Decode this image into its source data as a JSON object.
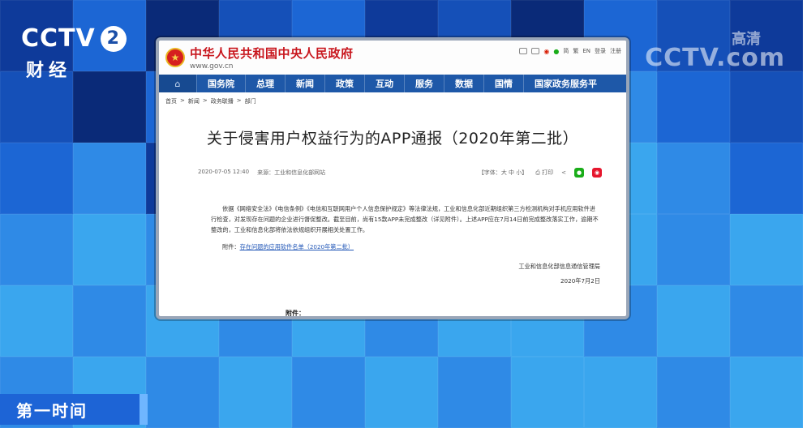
{
  "channel": {
    "logo": "CCTV",
    "number": "2",
    "name": "财经"
  },
  "hd_badge": {
    "label": "高清",
    "logo": "CCTV.com"
  },
  "site": {
    "title": "中华人民共和国中央人民政府",
    "url": "www.gov.cn",
    "emblem": "national-emblem-icon",
    "top_links": [
      "简",
      "繁",
      "EN",
      "登录",
      "注册"
    ],
    "nav": [
      "国务院",
      "总理",
      "新闻",
      "政策",
      "互动",
      "服务",
      "数据",
      "国情",
      "国家政务服务平"
    ]
  },
  "breadcrumb": [
    "首页",
    "新闻",
    "政务联播",
    "部门"
  ],
  "article": {
    "title": "关于侵害用户权益行为的APP通报（2020年第二批）",
    "date": "2020-07-05 12:40",
    "source_label": "来源：",
    "source": "工业和信息化部网站",
    "font_size_label": "【字体：",
    "font_sizes": [
      "大",
      "中",
      "小"
    ],
    "font_size_close": "】",
    "print_label": "打印",
    "paragraph": "依据《网络安全法》《电信条例》《电信和互联网用户个人信息保护规定》等法律法规，工业和信息化部近期组织第三方检测机构对手机应用软件进行检查，对发现存在问题的企业进行督促整改。截至目前，尚有15款APP未完成整改（详见附件）。上述APP应在7月14日前完成整改落实工作，逾期不整改的，工业和信息化部将依法依规组织开展相关处置工作。",
    "attachment_label": "附件：",
    "attachment_link": "存在问题的应用软件名单（2020年第二批）",
    "signature_org": "工业和信息化部信息通信管理局",
    "signature_date": "2020年7月2日",
    "bottom_fragment": "附件："
  },
  "caption": "第一时间",
  "colors": {
    "site_red": "#c8161d",
    "nav_blue": "#1e58a8",
    "caption_blue": "#1d64d6"
  }
}
